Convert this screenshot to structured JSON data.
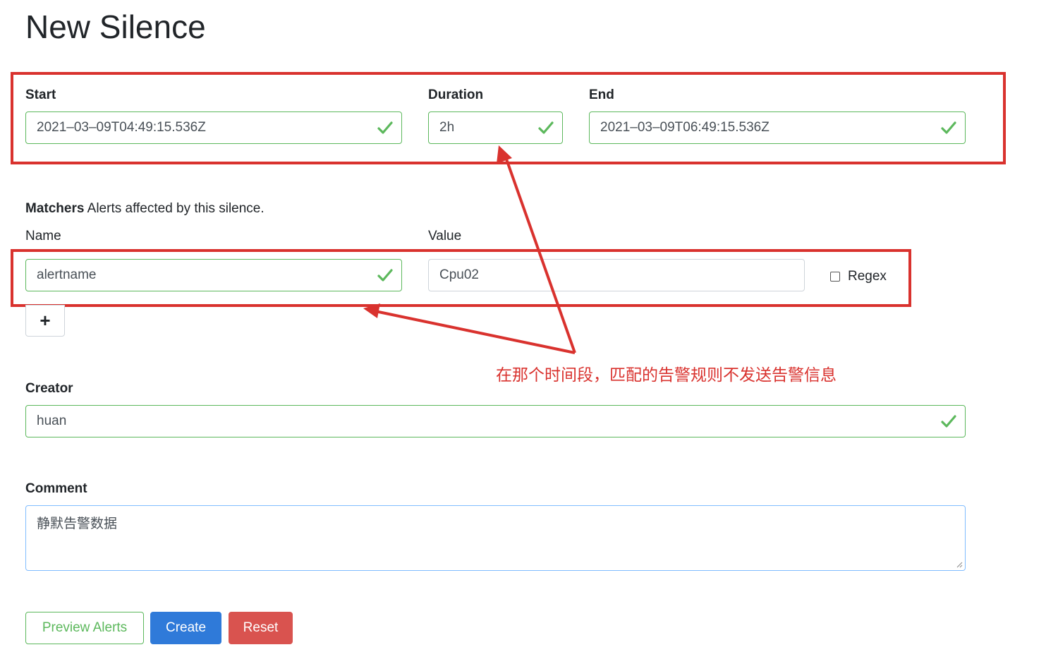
{
  "page": {
    "title": "New Silence"
  },
  "time": {
    "start_label": "Start",
    "start_value": "2021–03–09T04:49:15.536Z",
    "duration_label": "Duration",
    "duration_value": "2h",
    "end_label": "End",
    "end_value": "2021–03–09T06:49:15.536Z"
  },
  "matchers": {
    "label": "Matchers",
    "description": "Alerts affected by this silence.",
    "name_label": "Name",
    "value_label": "Value",
    "name_value": "alertname",
    "value_value": "Cpu02",
    "regex_label": "Regex",
    "regex_checked": false,
    "add_button": "+"
  },
  "creator": {
    "label": "Creator",
    "value": "huan"
  },
  "comment": {
    "label": "Comment",
    "value": "静默告警数据"
  },
  "actions": {
    "preview": "Preview Alerts",
    "create": "Create",
    "reset": "Reset"
  },
  "annotation": {
    "text": "在那个时间段，匹配的告警规则不发送告警信息"
  },
  "colors": {
    "valid": "#5cb85c",
    "primary": "#2f7ad9",
    "danger": "#d9534f",
    "annotation": "#d9322e"
  }
}
